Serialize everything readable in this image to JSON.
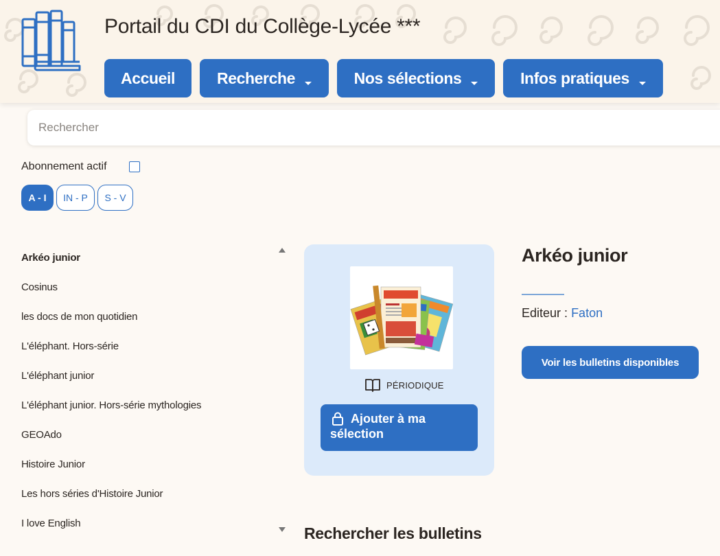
{
  "header": {
    "site_title": "Portail du CDI du Collège-Lycée ***",
    "nav": [
      {
        "label": "Accueil",
        "has_dropdown": false
      },
      {
        "label": "Recherche",
        "has_dropdown": true
      },
      {
        "label": "Nos sélections",
        "has_dropdown": true
      },
      {
        "label": "Infos pratiques",
        "has_dropdown": true
      }
    ]
  },
  "search": {
    "placeholder": "Rechercher",
    "value": ""
  },
  "filter": {
    "subscription_label": "Abonnement actif",
    "subscription_checked": false,
    "alpha_tabs": [
      {
        "label": "A - I",
        "active": true
      },
      {
        "label": "IN - P",
        "active": false
      },
      {
        "label": "S - V",
        "active": false
      }
    ]
  },
  "list": {
    "items": [
      "Arkéo junior",
      "Cosinus",
      "les docs de mon quotidien",
      "L'éléphant. Hors-série",
      "L'éléphant junior",
      "L'éléphant junior. Hors-série mythologies",
      "GEOAdo",
      "Histoire Junior",
      "Les hors séries d'Histoire Junior",
      "I love English"
    ],
    "selected_index": 0
  },
  "card": {
    "type_label": "PÉRIODIQUE",
    "add_button_label": "Ajouter à ma sélection"
  },
  "detail": {
    "title": "Arkéo junior",
    "editor_label": "Editeur :",
    "editor_value": "Faton",
    "bulletins_button": "Voir les bulletins disponibles"
  },
  "section": {
    "title": "Rechercher les bulletins"
  },
  "colors": {
    "accent": "#2e6fc3",
    "card_bg": "#dceafa",
    "page_bg": "#fdf9f4"
  }
}
